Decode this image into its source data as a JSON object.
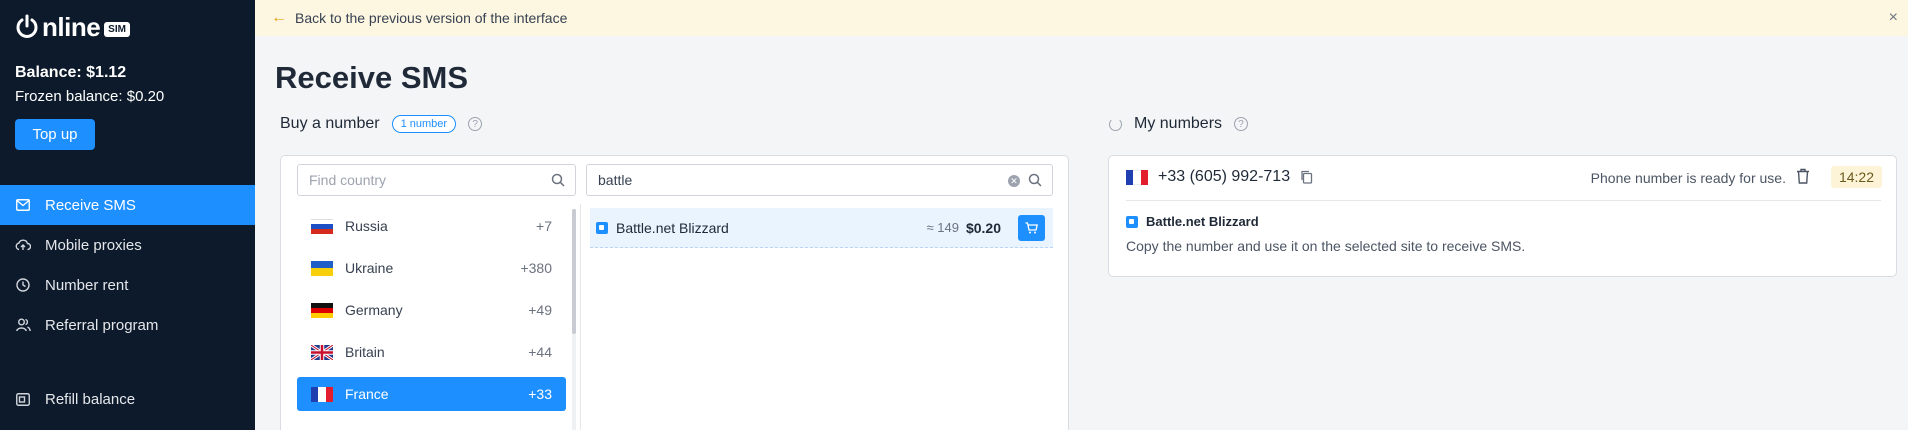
{
  "sidebar": {
    "logo_text": "nline",
    "logo_badge": "SIM",
    "balance": "Balance: $1.12",
    "frozen": "Frozen balance: $0.20",
    "topup_label": "Top up",
    "items": [
      {
        "label": "Receive SMS",
        "icon": "mail-icon",
        "active": true
      },
      {
        "label": "Mobile proxies",
        "icon": "cloud-upload-icon",
        "active": false
      },
      {
        "label": "Number rent",
        "icon": "clock-icon",
        "active": false
      },
      {
        "label": "Referral program",
        "icon": "users-icon",
        "active": false
      }
    ],
    "refill_label": "Refill balance"
  },
  "banner": {
    "text": "Back to the previous version of the interface",
    "close": "×"
  },
  "page_title": "Receive SMS",
  "buy": {
    "title": "Buy a number",
    "pill": "1 number",
    "help": "?",
    "country_placeholder": "Find country",
    "service_query": "battle",
    "countries": [
      {
        "name": "Russia",
        "code": "+7"
      },
      {
        "name": "Ukraine",
        "code": "+380"
      },
      {
        "name": "Germany",
        "code": "+49"
      },
      {
        "name": "Britain",
        "code": "+44"
      },
      {
        "name": "France",
        "code": "+33",
        "active": true
      }
    ],
    "service": {
      "name": "Battle.net Blizzard",
      "qty": "≈ 149",
      "price": "$0.20"
    }
  },
  "my_numbers": {
    "title": "My numbers",
    "help": "?",
    "number": "+33 (605) 992-713",
    "status": "Phone number is ready for use.",
    "timer": "14:22",
    "service": "Battle.net Blizzard",
    "hint": "Copy the number and use it on the selected site to receive SMS."
  },
  "colors": {
    "accent": "#1e8fff",
    "sidebar_bg": "#0c1a2b",
    "banner_bg": "#fdf7e2"
  }
}
